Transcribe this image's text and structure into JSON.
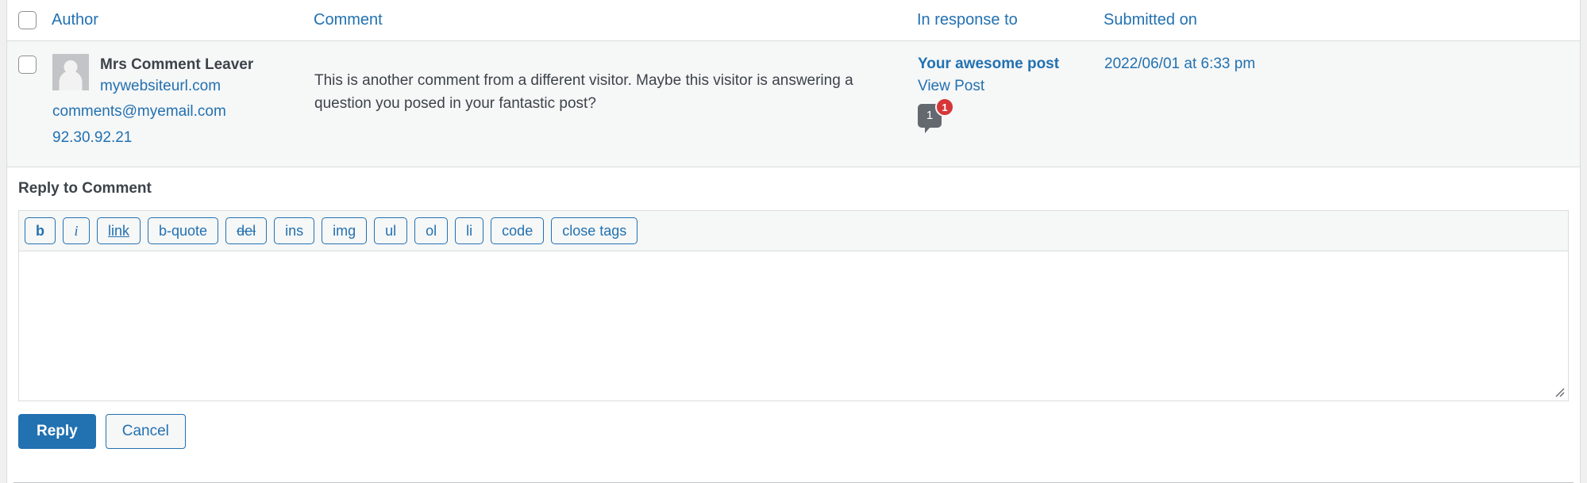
{
  "table": {
    "columns": {
      "select_all_label": "Select All",
      "author": "Author",
      "comment": "Comment",
      "in_response_to": "In response to",
      "submitted_on": "Submitted on"
    },
    "rows": [
      {
        "author": {
          "name": "Mrs Comment Leaver",
          "website": "mywebsiteurl.com",
          "email": "comments@myemail.com",
          "ip": "92.30.92.21",
          "avatar_icon": "mystery-person-avatar-icon"
        },
        "comment_text": "This is another comment from a different visitor. Maybe this visitor is answering a question you posed in your fantastic post?",
        "in_response_to": {
          "post_title": "Your awesome post",
          "view_post_label": "View Post",
          "comment_count": "1",
          "pending_count": "1"
        },
        "submitted_on": "2022/06/01 at 6:33 pm"
      }
    ]
  },
  "reply": {
    "heading": "Reply to Comment",
    "toolbar_buttons": [
      {
        "label": "b",
        "style": "bold",
        "name": "quicktag-bold"
      },
      {
        "label": "i",
        "style": "italic",
        "name": "quicktag-italic"
      },
      {
        "label": "link",
        "style": "underline",
        "name": "quicktag-link"
      },
      {
        "label": "b-quote",
        "style": "plain",
        "name": "quicktag-blockquote"
      },
      {
        "label": "del",
        "style": "strike",
        "name": "quicktag-del"
      },
      {
        "label": "ins",
        "style": "plain",
        "name": "quicktag-ins"
      },
      {
        "label": "img",
        "style": "plain",
        "name": "quicktag-img"
      },
      {
        "label": "ul",
        "style": "plain",
        "name": "quicktag-ul"
      },
      {
        "label": "ol",
        "style": "plain",
        "name": "quicktag-ol"
      },
      {
        "label": "li",
        "style": "plain",
        "name": "quicktag-li"
      },
      {
        "label": "code",
        "style": "plain",
        "name": "quicktag-code"
      },
      {
        "label": "close tags",
        "style": "plain",
        "name": "quicktag-close-tags"
      }
    ],
    "textarea_value": "",
    "textarea_placeholder": "",
    "submit_label": "Reply",
    "cancel_label": "Cancel"
  },
  "colors": {
    "link": "#2271b1",
    "primary_button": "#2271b1",
    "text": "#3c434a",
    "row_background": "#f6f7f7",
    "badge_red": "#d63638",
    "bubble_gray": "#646970"
  }
}
